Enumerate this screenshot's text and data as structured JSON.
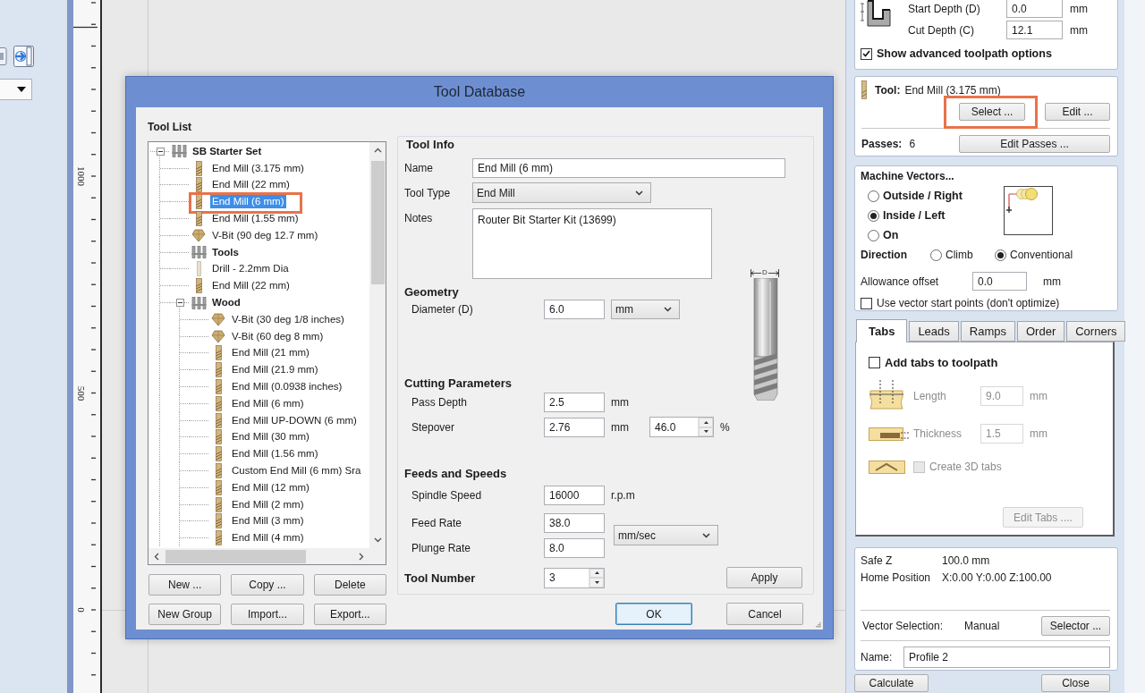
{
  "ruler": {
    "labels": [
      "1000",
      "500",
      "0"
    ]
  },
  "dialog": {
    "title": "Tool Database",
    "tool_list": {
      "title": "Tool List",
      "items": [
        {
          "label": "SB Starter Set",
          "kind": "group",
          "expanded": true,
          "selected": false,
          "highlighted": false,
          "children": [
            {
              "label": "End Mill (3.175 mm)",
              "kind": "end_mill",
              "selected": false,
              "highlighted": false
            },
            {
              "label": "End Mill (22 mm)",
              "kind": "end_mill",
              "selected": false,
              "highlighted": false
            },
            {
              "label": "End Mill (6 mm)",
              "kind": "end_mill",
              "selected": true,
              "highlighted": true
            },
            {
              "label": "End Mill (1.55 mm)",
              "kind": "end_mill",
              "selected": false,
              "highlighted": false
            },
            {
              "label": "V-Bit (90 deg 12.7 mm)",
              "kind": "v_bit",
              "selected": false,
              "highlighted": false
            },
            {
              "label": "Tools",
              "kind": "group",
              "selected": false,
              "highlighted": false
            },
            {
              "label": "Drill - 2.2mm Dia",
              "kind": "drill",
              "selected": false,
              "highlighted": false
            },
            {
              "label": "End Mill (22 mm)",
              "kind": "end_mill",
              "selected": false,
              "highlighted": false
            },
            {
              "label": "Wood",
              "kind": "group",
              "expanded": true,
              "selected": false,
              "highlighted": false,
              "children": [
                {
                  "label": "V-Bit (30 deg 1/8 inches)",
                  "kind": "v_bit",
                  "selected": false,
                  "highlighted": false
                },
                {
                  "label": "V-Bit (60 deg 8 mm)",
                  "kind": "v_bit",
                  "selected": false,
                  "highlighted": false
                },
                {
                  "label": "End Mill (21 mm)",
                  "kind": "end_mill",
                  "selected": false,
                  "highlighted": false
                },
                {
                  "label": "End Mill (21.9 mm)",
                  "kind": "end_mill",
                  "selected": false,
                  "highlighted": false
                },
                {
                  "label": "End Mill (0.0938 inches)",
                  "kind": "end_mill",
                  "selected": false,
                  "highlighted": false
                },
                {
                  "label": "End Mill (6 mm)",
                  "kind": "end_mill",
                  "selected": false,
                  "highlighted": false
                },
                {
                  "label": "End Mill UP-DOWN (6 mm)",
                  "kind": "end_mill",
                  "selected": false,
                  "highlighted": false
                },
                {
                  "label": "End Mill (30 mm)",
                  "kind": "end_mill",
                  "selected": false,
                  "highlighted": false
                },
                {
                  "label": "End Mill (1.56 mm)",
                  "kind": "end_mill",
                  "selected": false,
                  "highlighted": false
                },
                {
                  "label": "Custom End Mill (6 mm) Sra",
                  "kind": "end_mill",
                  "selected": false,
                  "highlighted": false
                },
                {
                  "label": "End Mill (12 mm)",
                  "kind": "end_mill",
                  "selected": false,
                  "highlighted": false
                },
                {
                  "label": "End Mill (2 mm)",
                  "kind": "end_mill",
                  "selected": false,
                  "highlighted": false
                },
                {
                  "label": "End Mill (3 mm)",
                  "kind": "end_mill",
                  "selected": false,
                  "highlighted": false
                },
                {
                  "label": "End Mill (4 mm)",
                  "kind": "end_mill",
                  "selected": false,
                  "highlighted": false
                }
              ]
            }
          ]
        }
      ],
      "buttons": {
        "new": "New ...",
        "copy": "Copy ...",
        "delete": "Delete",
        "new_group": "New Group",
        "import": "Import...",
        "export": "Export..."
      }
    },
    "tool_info": {
      "title": "Tool Info",
      "name": {
        "label": "Name",
        "value": "End Mill (6 mm)"
      },
      "tool_type": {
        "label": "Tool Type",
        "value": "End Mill"
      },
      "notes": {
        "label": "Notes",
        "value": "Router Bit Starter Kit (13699)"
      },
      "diagram_label": "D",
      "geometry": {
        "title": "Geometry",
        "diameter": {
          "label": "Diameter (D)",
          "value": "6.0",
          "unit": "mm"
        }
      },
      "cutting": {
        "title": "Cutting Parameters",
        "pass_depth": {
          "label": "Pass Depth",
          "value": "2.5",
          "unit": "mm"
        },
        "stepover": {
          "label": "Stepover",
          "value": "2.76",
          "unit": "mm",
          "percent": "46.0",
          "percent_unit": "%"
        }
      },
      "feeds": {
        "title": "Feeds and Speeds",
        "spindle_speed": {
          "label": "Spindle Speed",
          "value": "16000",
          "unit": "r.p.m"
        },
        "feed_rate": {
          "label": "Feed Rate",
          "value": "38.0"
        },
        "plunge_rate": {
          "label": "Plunge Rate",
          "value": "8.0"
        },
        "rate_unit": "mm/sec"
      },
      "tool_number": {
        "label": "Tool Number",
        "value": "3"
      },
      "apply": "Apply"
    },
    "ok": {
      "label": "OK",
      "focused": true
    },
    "cancel": {
      "label": "Cancel",
      "focused": false
    }
  },
  "toolpath": {
    "start_depth": {
      "label": "Start Depth (D)",
      "value": "0.0",
      "unit": "mm"
    },
    "cut_depth": {
      "label": "Cut Depth (C)",
      "value": "12.1",
      "unit": "mm"
    },
    "advanced": {
      "label": "Show advanced toolpath options",
      "checked": true
    },
    "tool": {
      "label": "Tool:",
      "name": "End Mill (3.175 mm)",
      "select": {
        "label": "Select ...",
        "highlighted": true
      },
      "edit": {
        "label": "Edit ...",
        "highlighted": false
      },
      "passes_label": "Passes:",
      "passes": "6",
      "edit_passes": "Edit Passes ..."
    },
    "machine_vectors": {
      "title": "Machine Vectors...",
      "sides": [
        {
          "label": "Outside / Right",
          "selected": false
        },
        {
          "label": "Inside / Left",
          "selected": true
        },
        {
          "label": "On",
          "selected": false
        }
      ],
      "direction_label": "Direction",
      "directions": [
        {
          "label": "Climb",
          "selected": false
        },
        {
          "label": "Conventional",
          "selected": true
        }
      ],
      "allowance": {
        "label": "Allowance offset",
        "value": "0.0",
        "unit": "mm"
      },
      "start_points": {
        "label": "Use vector start points (don't optimize)",
        "checked": false
      }
    },
    "tabs": [
      {
        "label": "Tabs",
        "selected": true
      },
      {
        "label": "Leads",
        "selected": false
      },
      {
        "label": "Ramps",
        "selected": false
      },
      {
        "label": "Order",
        "selected": false
      },
      {
        "label": "Corners",
        "selected": false
      }
    ],
    "tab_options": {
      "add_tabs": {
        "label": "Add tabs to toolpath",
        "checked": false
      },
      "length": {
        "label": "Length",
        "value": "9.0",
        "unit": "mm"
      },
      "thickness": {
        "label": "Thickness",
        "value": "1.5",
        "unit": "mm"
      },
      "create_3d": {
        "label": "Create 3D tabs",
        "checked": false
      },
      "edit_tabs": "Edit Tabs ...."
    },
    "safe_z": {
      "label": "Safe Z",
      "value": "100.0 mm"
    },
    "home_position": {
      "label": "Home Position",
      "value": "X:0.00 Y:0.00 Z:100.00"
    },
    "vector_selection": {
      "label": "Vector Selection:",
      "value": "Manual",
      "button": "Selector ..."
    },
    "name": {
      "label": "Name:",
      "value": "Profile 2"
    },
    "calculate": "Calculate",
    "close": "Close"
  }
}
